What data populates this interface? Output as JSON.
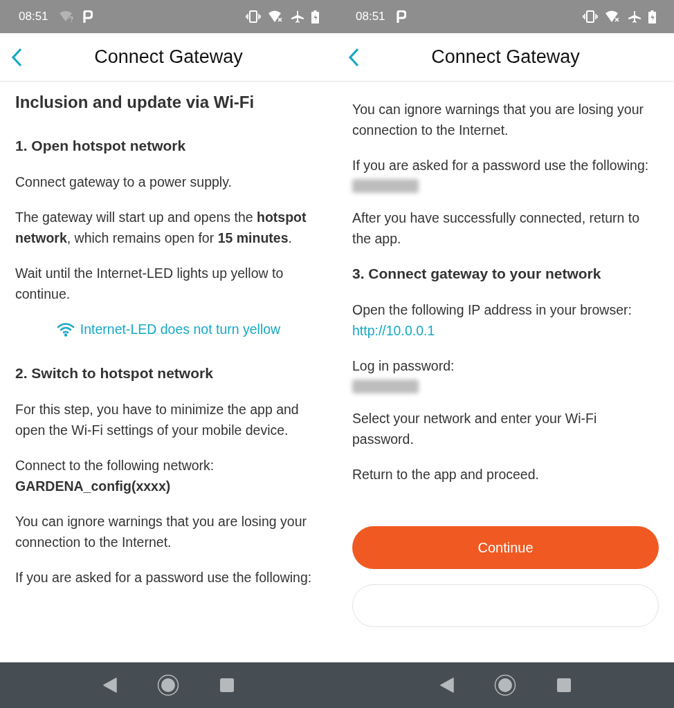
{
  "screens": [
    {
      "status_bar": {
        "time": "08:51",
        "notifications": [
          {
            "kind": "wifi_unknown"
          },
          {
            "kind": "app"
          }
        ]
      },
      "header": {
        "title": "Connect Gateway"
      },
      "content": [
        {
          "kind": "h1",
          "text": "Inclusion and update via Wi-Fi"
        },
        {
          "kind": "h2",
          "text": "1. Open hotspot network"
        },
        {
          "kind": "p",
          "text": "Connect gateway to a power supply."
        },
        {
          "kind": "p",
          "text": "The gateway will start up and opens the **hotspot network**, which remains open for **15 minutes**."
        },
        {
          "kind": "p",
          "text": "Wait until the Internet-LED lights up yellow to continue."
        },
        {
          "kind": "help_link",
          "text": "Internet-LED does not turn yellow"
        },
        {
          "kind": "h2",
          "text": "2. Switch to hotspot network"
        },
        {
          "kind": "p",
          "text": "For this step, you have to minimize the app and open the Wi-Fi settings of your mobile device."
        },
        {
          "kind": "p",
          "text": "Connect to the following network:\n**GARDENA_config(xxxx)**"
        },
        {
          "kind": "p",
          "text": "You can ignore warnings that you are losing your connection to the Internet."
        },
        {
          "kind": "p",
          "text": "If you are asked for a password use the following:"
        }
      ]
    },
    {
      "status_bar": {
        "time": "08:51",
        "notifications": [
          {
            "kind": "app"
          }
        ]
      },
      "header": {
        "title": "Connect Gateway"
      },
      "content": [
        {
          "kind": "p",
          "text": "You can ignore warnings that you are losing your connection to the Internet."
        },
        {
          "kind": "p_redacted",
          "text": "If you are asked for a password use the following:"
        },
        {
          "kind": "p",
          "text": "After you have successfully connected, return to the app."
        },
        {
          "kind": "h2",
          "text": "3. Connect gateway to your network"
        },
        {
          "kind": "p_link",
          "text": "Open the following IP address in your browser:",
          "link": "http://10.0.0.1"
        },
        {
          "kind": "p_redacted",
          "text": "Log in password:"
        },
        {
          "kind": "p",
          "text": "Select your network and enter your Wi-Fi password."
        },
        {
          "kind": "p",
          "text": "Return to the app and proceed."
        },
        {
          "kind": "primary_button",
          "text": "Continue"
        },
        {
          "kind": "outline_button"
        }
      ]
    }
  ]
}
